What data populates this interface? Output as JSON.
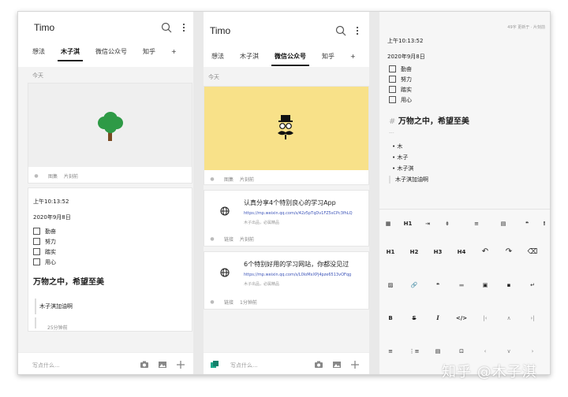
{
  "app": {
    "title": "Timo"
  },
  "tabs": [
    "想法",
    "木子淇",
    "微信公众号",
    "知乎",
    "+"
  ],
  "panel1": {
    "active_tab": 1,
    "section_date": "今天",
    "image_card": {
      "meta_type": "图集",
      "meta_time": "片刻前"
    },
    "note_card": {
      "time": "上午10:13:52",
      "date": "2020年9月8日",
      "checklist": [
        "勤奋",
        "努力",
        "踏实",
        "用心"
      ],
      "heading": "万物之中，希望至美",
      "quote": "木子淇加油啊",
      "meta_time": "25分钟前"
    },
    "input_placeholder": "写点什么..."
  },
  "panel2": {
    "active_tab": 2,
    "section_date": "今天",
    "image_card": {
      "meta_type": "图集",
      "meta_time": "片刻前"
    },
    "links": [
      {
        "title": "认真分享4个特别良心的学习App",
        "url": "https://mp.weixin.qq.com/s/42z5pTqDv1FZ5sCPc3fhLQ",
        "source": "木子出品，必属精品",
        "meta_type": "链接",
        "meta_time": "片刻前"
      },
      {
        "title": "6个特别好用的学习网站，你都没见过",
        "url": "https://mp.weixin.qq.com/s/L0loMxXPj4pze6513vOFqg",
        "source": "木子出品，必属精品",
        "meta_type": "链接",
        "meta_time": "1分钟前"
      }
    ],
    "input_placeholder": "写点什么..."
  },
  "panel3": {
    "stats": "49字  更新于 · 片刻前",
    "time": "上午10:13:52",
    "date": "2020年9月8日",
    "checklist": [
      "勤奋",
      "努力",
      "踏实",
      "用心"
    ],
    "heading_mark": "#",
    "heading": "万物之中，希望至美",
    "hr": "---",
    "bullets": [
      "木",
      "木子",
      "木子淇"
    ],
    "quote": "木子淇加油啊",
    "toolbar_row1": [
      "▦",
      "H1",
      "⇥",
      "⇟",
      "≡",
      "▤",
      "❝",
      "!"
    ],
    "toolbar_row2": [
      "H1",
      "H2",
      "H3",
      "H4",
      "↶",
      "↷",
      "⌫"
    ],
    "toolbar_row3": [
      "▨",
      "🔗",
      "❝",
      "▬",
      "▣",
      "▪",
      "↵"
    ],
    "toolbar_row4": [
      "B",
      "S",
      "I",
      "</>",
      "|‹",
      "∧",
      "›|"
    ],
    "toolbar_row5": [
      "≡",
      "⋮≡",
      "▤",
      "⊡",
      "‹",
      "∨",
      "›"
    ]
  },
  "watermark": "知乎 @木子淇",
  "colors": {
    "image_bg_yellow": "#f8e189",
    "image_bg_gray": "#efefef",
    "tree_green": "#2e9a46",
    "accent_teal": "#1aa88a"
  }
}
